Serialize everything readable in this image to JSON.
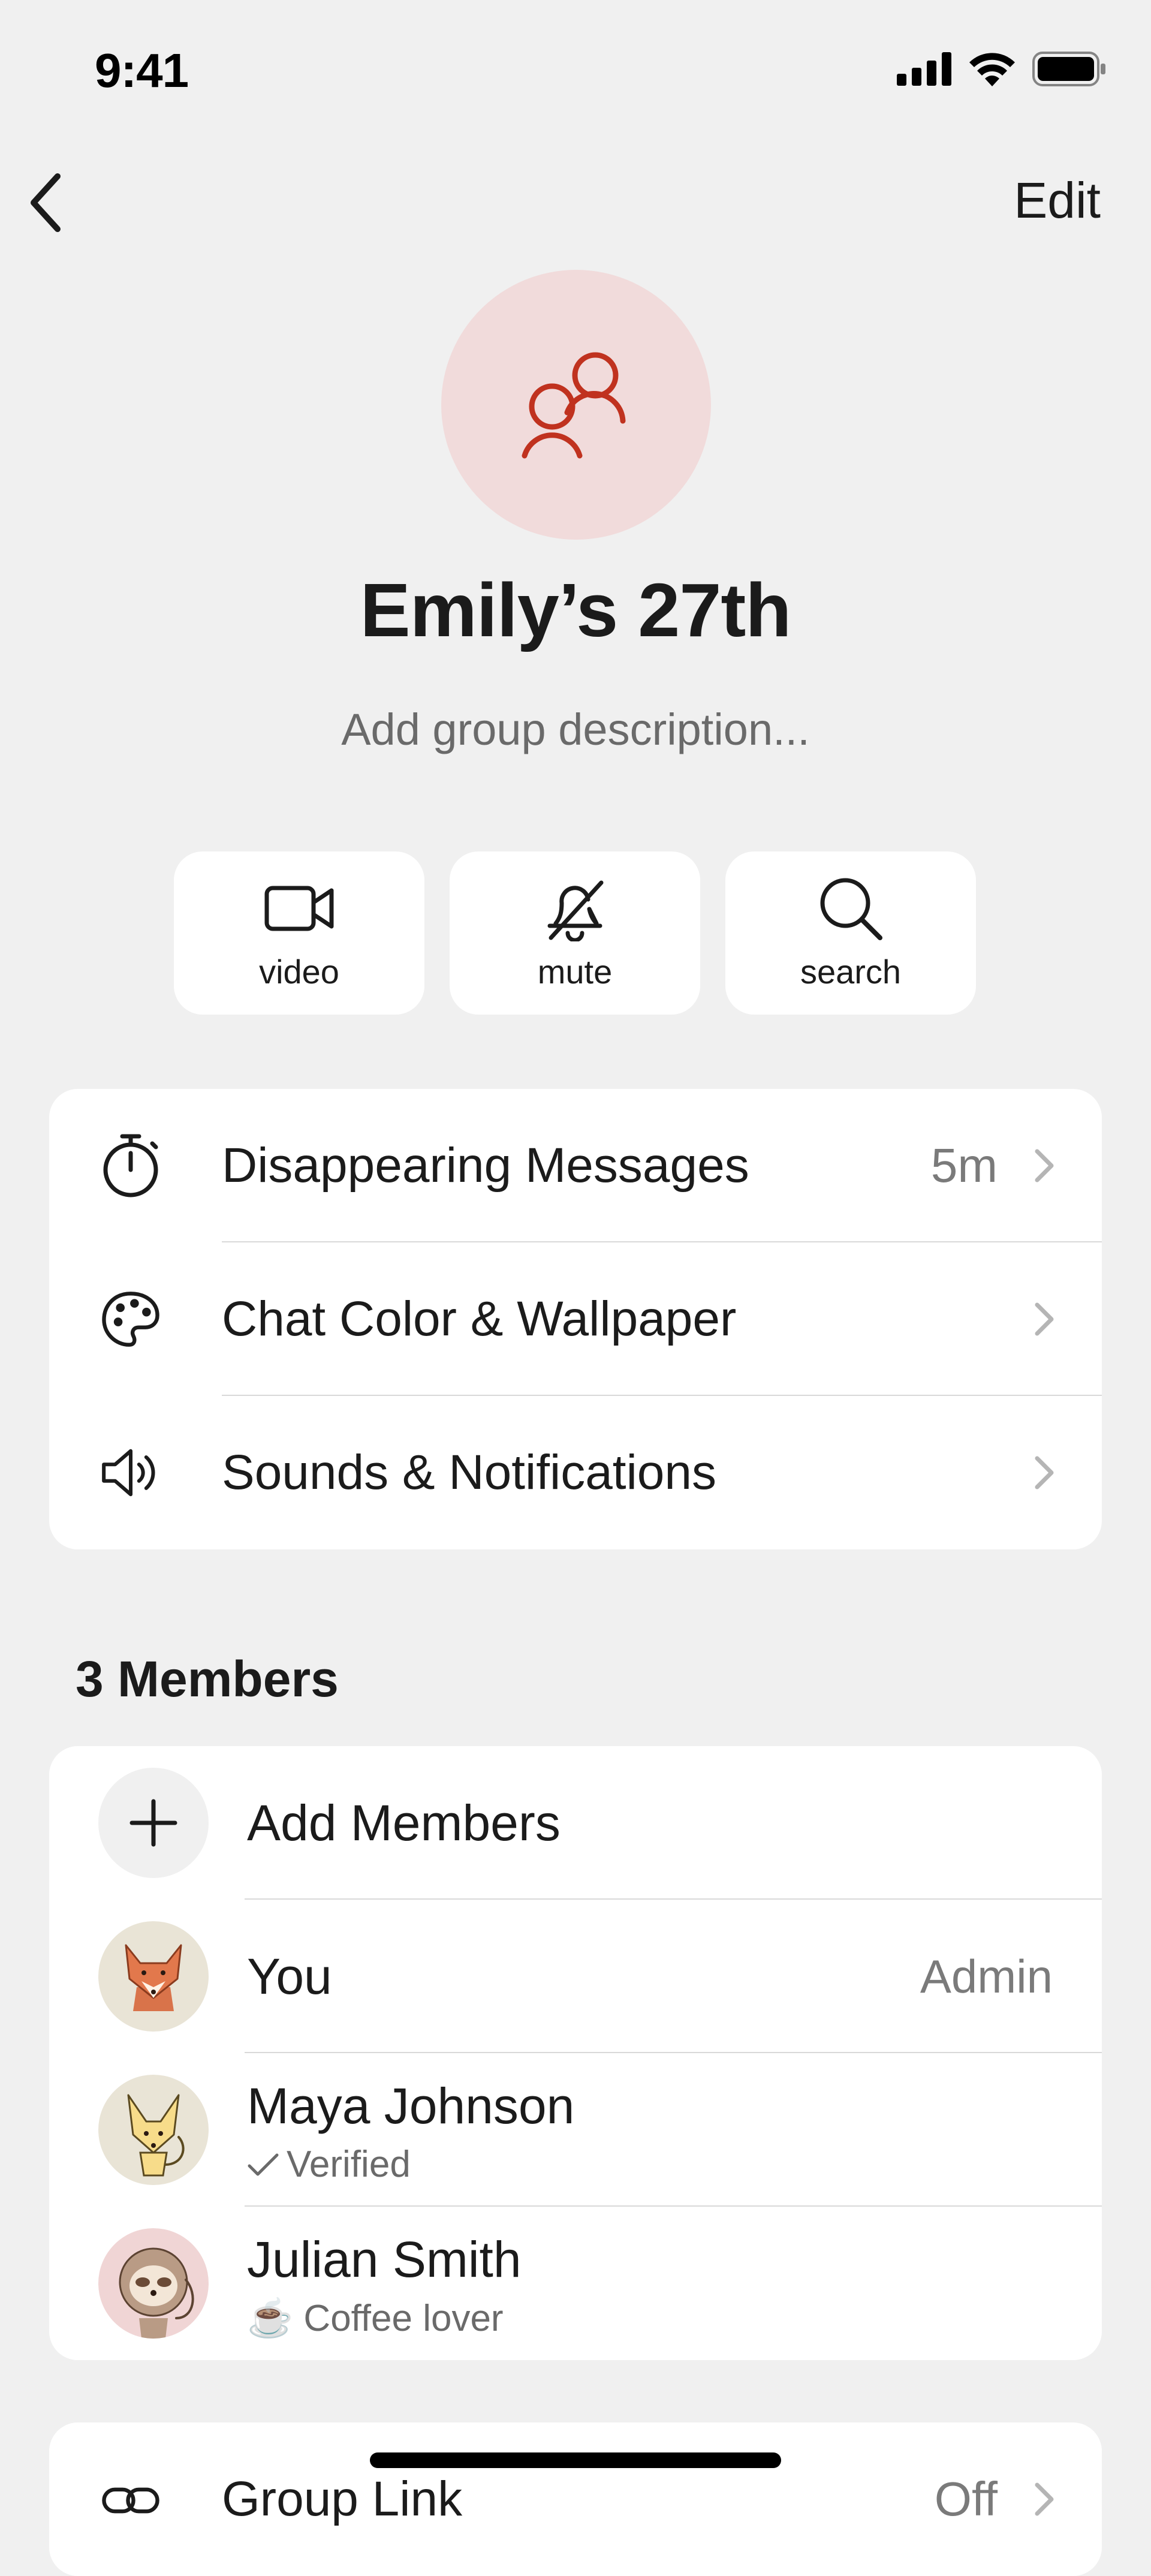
{
  "status_bar": {
    "time": "9:41"
  },
  "nav": {
    "back_icon": "chevron-left-icon",
    "edit_label": "Edit"
  },
  "group": {
    "avatar_icon": "group-icon",
    "name": "Emily’s 27th",
    "description_placeholder": "Add group description..."
  },
  "actions": [
    {
      "label": "video",
      "icon": "video-camera-icon"
    },
    {
      "label": "mute",
      "icon": "bell-slash-icon"
    },
    {
      "label": "search",
      "icon": "search-icon"
    }
  ],
  "settings": [
    {
      "label": "Disappearing Messages",
      "value": "5m",
      "icon": "timer-icon"
    },
    {
      "label": "Chat Color & Wallpaper",
      "value": "",
      "icon": "palette-icon"
    },
    {
      "label": "Sounds & Notifications",
      "value": "",
      "icon": "speaker-icon"
    }
  ],
  "members": {
    "title": "3 Members",
    "add_label": "Add Members",
    "list": [
      {
        "name": "You",
        "role": "Admin",
        "subtitle": ""
      },
      {
        "name": "Maya Johnson",
        "role": "",
        "subtitle": "Verified"
      },
      {
        "name": "Julian Smith",
        "role": "",
        "subtitle": "☕ Coffee lover"
      }
    ]
  },
  "group_link": {
    "label": "Group Link",
    "value": "Off"
  },
  "colors": {
    "accent": "#c0321f",
    "avatar_bg": "#f1dbdb",
    "background": "#f0f0f0",
    "card": "#ffffff",
    "secondary_text": "#6a6a6a"
  }
}
